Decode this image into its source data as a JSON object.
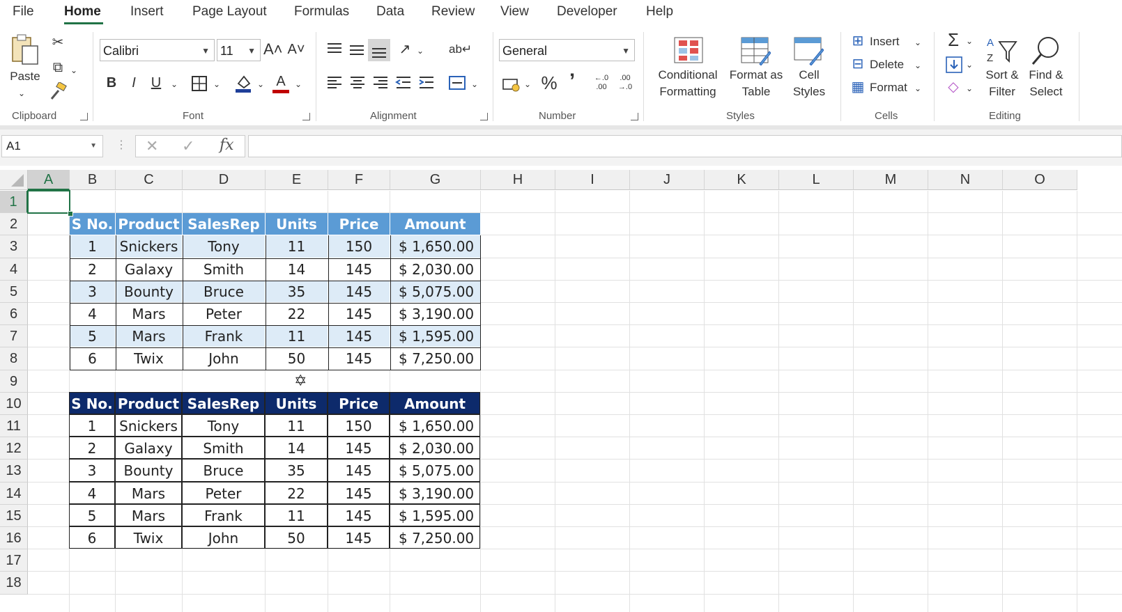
{
  "menu": {
    "tabs": [
      "File",
      "Home",
      "Insert",
      "Page Layout",
      "Formulas",
      "Data",
      "Review",
      "View",
      "Developer",
      "Help"
    ],
    "active": "Home"
  },
  "ribbon": {
    "clipboard": {
      "label": "Clipboard",
      "paste": "Paste"
    },
    "font": {
      "label": "Font",
      "name": "Calibri",
      "size": "11",
      "bold": "B",
      "italic": "I",
      "underline": "U",
      "grow": "A˄",
      "shrink": "A˅",
      "font_color_letter": "A"
    },
    "alignment": {
      "label": "Alignment"
    },
    "number": {
      "label": "Number",
      "format": "General",
      "percent": "%",
      "comma": "’"
    },
    "styles": {
      "label": "Styles",
      "conditional_1": "Conditional",
      "conditional_2": "Formatting",
      "format_as_1": "Format as",
      "format_as_2": "Table",
      "cell_styles_1": "Cell",
      "cell_styles_2": "Styles"
    },
    "cells": {
      "label": "Cells",
      "insert": "Insert",
      "delete": "Delete",
      "format": "Format"
    },
    "editing": {
      "label": "Editing",
      "sort_1": "Sort &",
      "sort_2": "Filter",
      "find_1": "Find &",
      "find_2": "Select"
    }
  },
  "formula_bar": {
    "name_box": "A1",
    "formula": ""
  },
  "grid": {
    "columns": [
      "A",
      "B",
      "C",
      "D",
      "E",
      "F",
      "G",
      "H",
      "I",
      "J",
      "K",
      "L",
      "M",
      "N",
      "O"
    ],
    "rows": [
      "1",
      "2",
      "3",
      "4",
      "5",
      "6",
      "7",
      "8",
      "9",
      "10",
      "11",
      "12",
      "13",
      "14",
      "15",
      "16",
      "17",
      "18"
    ],
    "selected_cell": "A1"
  },
  "table1": {
    "headers": [
      "S No.",
      "Product",
      "SalesRep",
      "Units",
      "Price",
      "Amount"
    ],
    "rows": [
      [
        "1",
        "Snickers",
        "Tony",
        "11",
        "150",
        "$ 1,650.00"
      ],
      [
        "2",
        "Galaxy",
        "Smith",
        "14",
        "145",
        "$ 2,030.00"
      ],
      [
        "3",
        "Bounty",
        "Bruce",
        "35",
        "145",
        "$ 5,075.00"
      ],
      [
        "4",
        "Mars",
        "Peter",
        "22",
        "145",
        "$ 3,190.00"
      ],
      [
        "5",
        "Mars",
        "Frank",
        "11",
        "145",
        "$ 1,595.00"
      ],
      [
        "6",
        "Twix",
        "John",
        "50",
        "145",
        "$ 7,250.00"
      ]
    ]
  },
  "table2": {
    "headers": [
      "S No.",
      "Product",
      "SalesRep",
      "Units",
      "Price",
      "Amount"
    ],
    "rows": [
      [
        "1",
        "Snickers",
        "Tony",
        "11",
        "150",
        "$ 1,650.00"
      ],
      [
        "2",
        "Galaxy",
        "Smith",
        "14",
        "145",
        "$ 2,030.00"
      ],
      [
        "3",
        "Bounty",
        "Bruce",
        "35",
        "145",
        "$ 5,075.00"
      ],
      [
        "4",
        "Mars",
        "Peter",
        "22",
        "145",
        "$ 3,190.00"
      ],
      [
        "5",
        "Mars",
        "Frank",
        "11",
        "145",
        "$ 1,595.00"
      ],
      [
        "6",
        "Twix",
        "John",
        "50",
        "145",
        "$ 7,250.00"
      ]
    ]
  },
  "colors": {
    "accent": "#217346",
    "table1_header": "#5b9bd5",
    "table1_band": "#ddebf7",
    "table2_header": "#0d2a6b"
  }
}
